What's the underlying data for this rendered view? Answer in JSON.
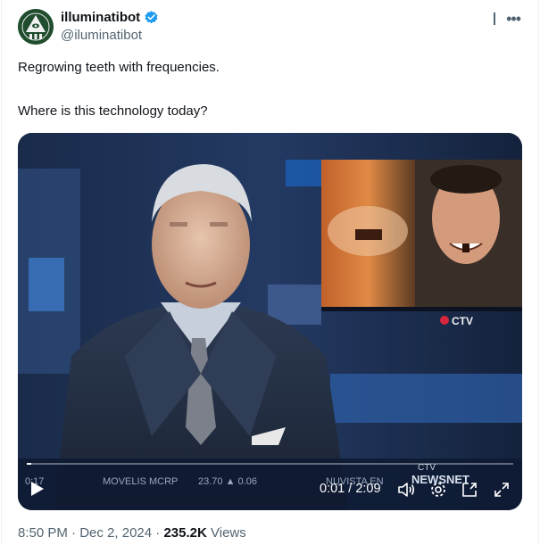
{
  "author": {
    "display_name": "illuminatibot",
    "handle": "@iluminatibot",
    "verified": true,
    "avatar_icon": "pyramid-eye-icon"
  },
  "tweet": {
    "lines": [
      "Regrowing teeth with frequencies.",
      "Where is this technology today?"
    ]
  },
  "video": {
    "current_time": "0:01",
    "separator": " / ",
    "duration": "2:09",
    "progress_percent": 1,
    "overlay_texts": {
      "channel_logo": "CTV",
      "ticker_left": "0:17",
      "ticker_stock": "MOVELIS MCRP",
      "ticker_values": "23.70 ▲ 0.06",
      "ticker_right": "NUVISTA EN",
      "network_tag": "CTV",
      "network_name": "NEWSNET"
    }
  },
  "meta": {
    "time": "8:50 PM",
    "date": "Dec 2, 2024",
    "views_count": "235.2K",
    "views_label": "Views",
    "separator": "·"
  },
  "colors": {
    "text_primary": "#0f1419",
    "text_secondary": "#536471",
    "verified_blue": "#1d9bf0",
    "avatar_green": "#1f4d2e"
  }
}
